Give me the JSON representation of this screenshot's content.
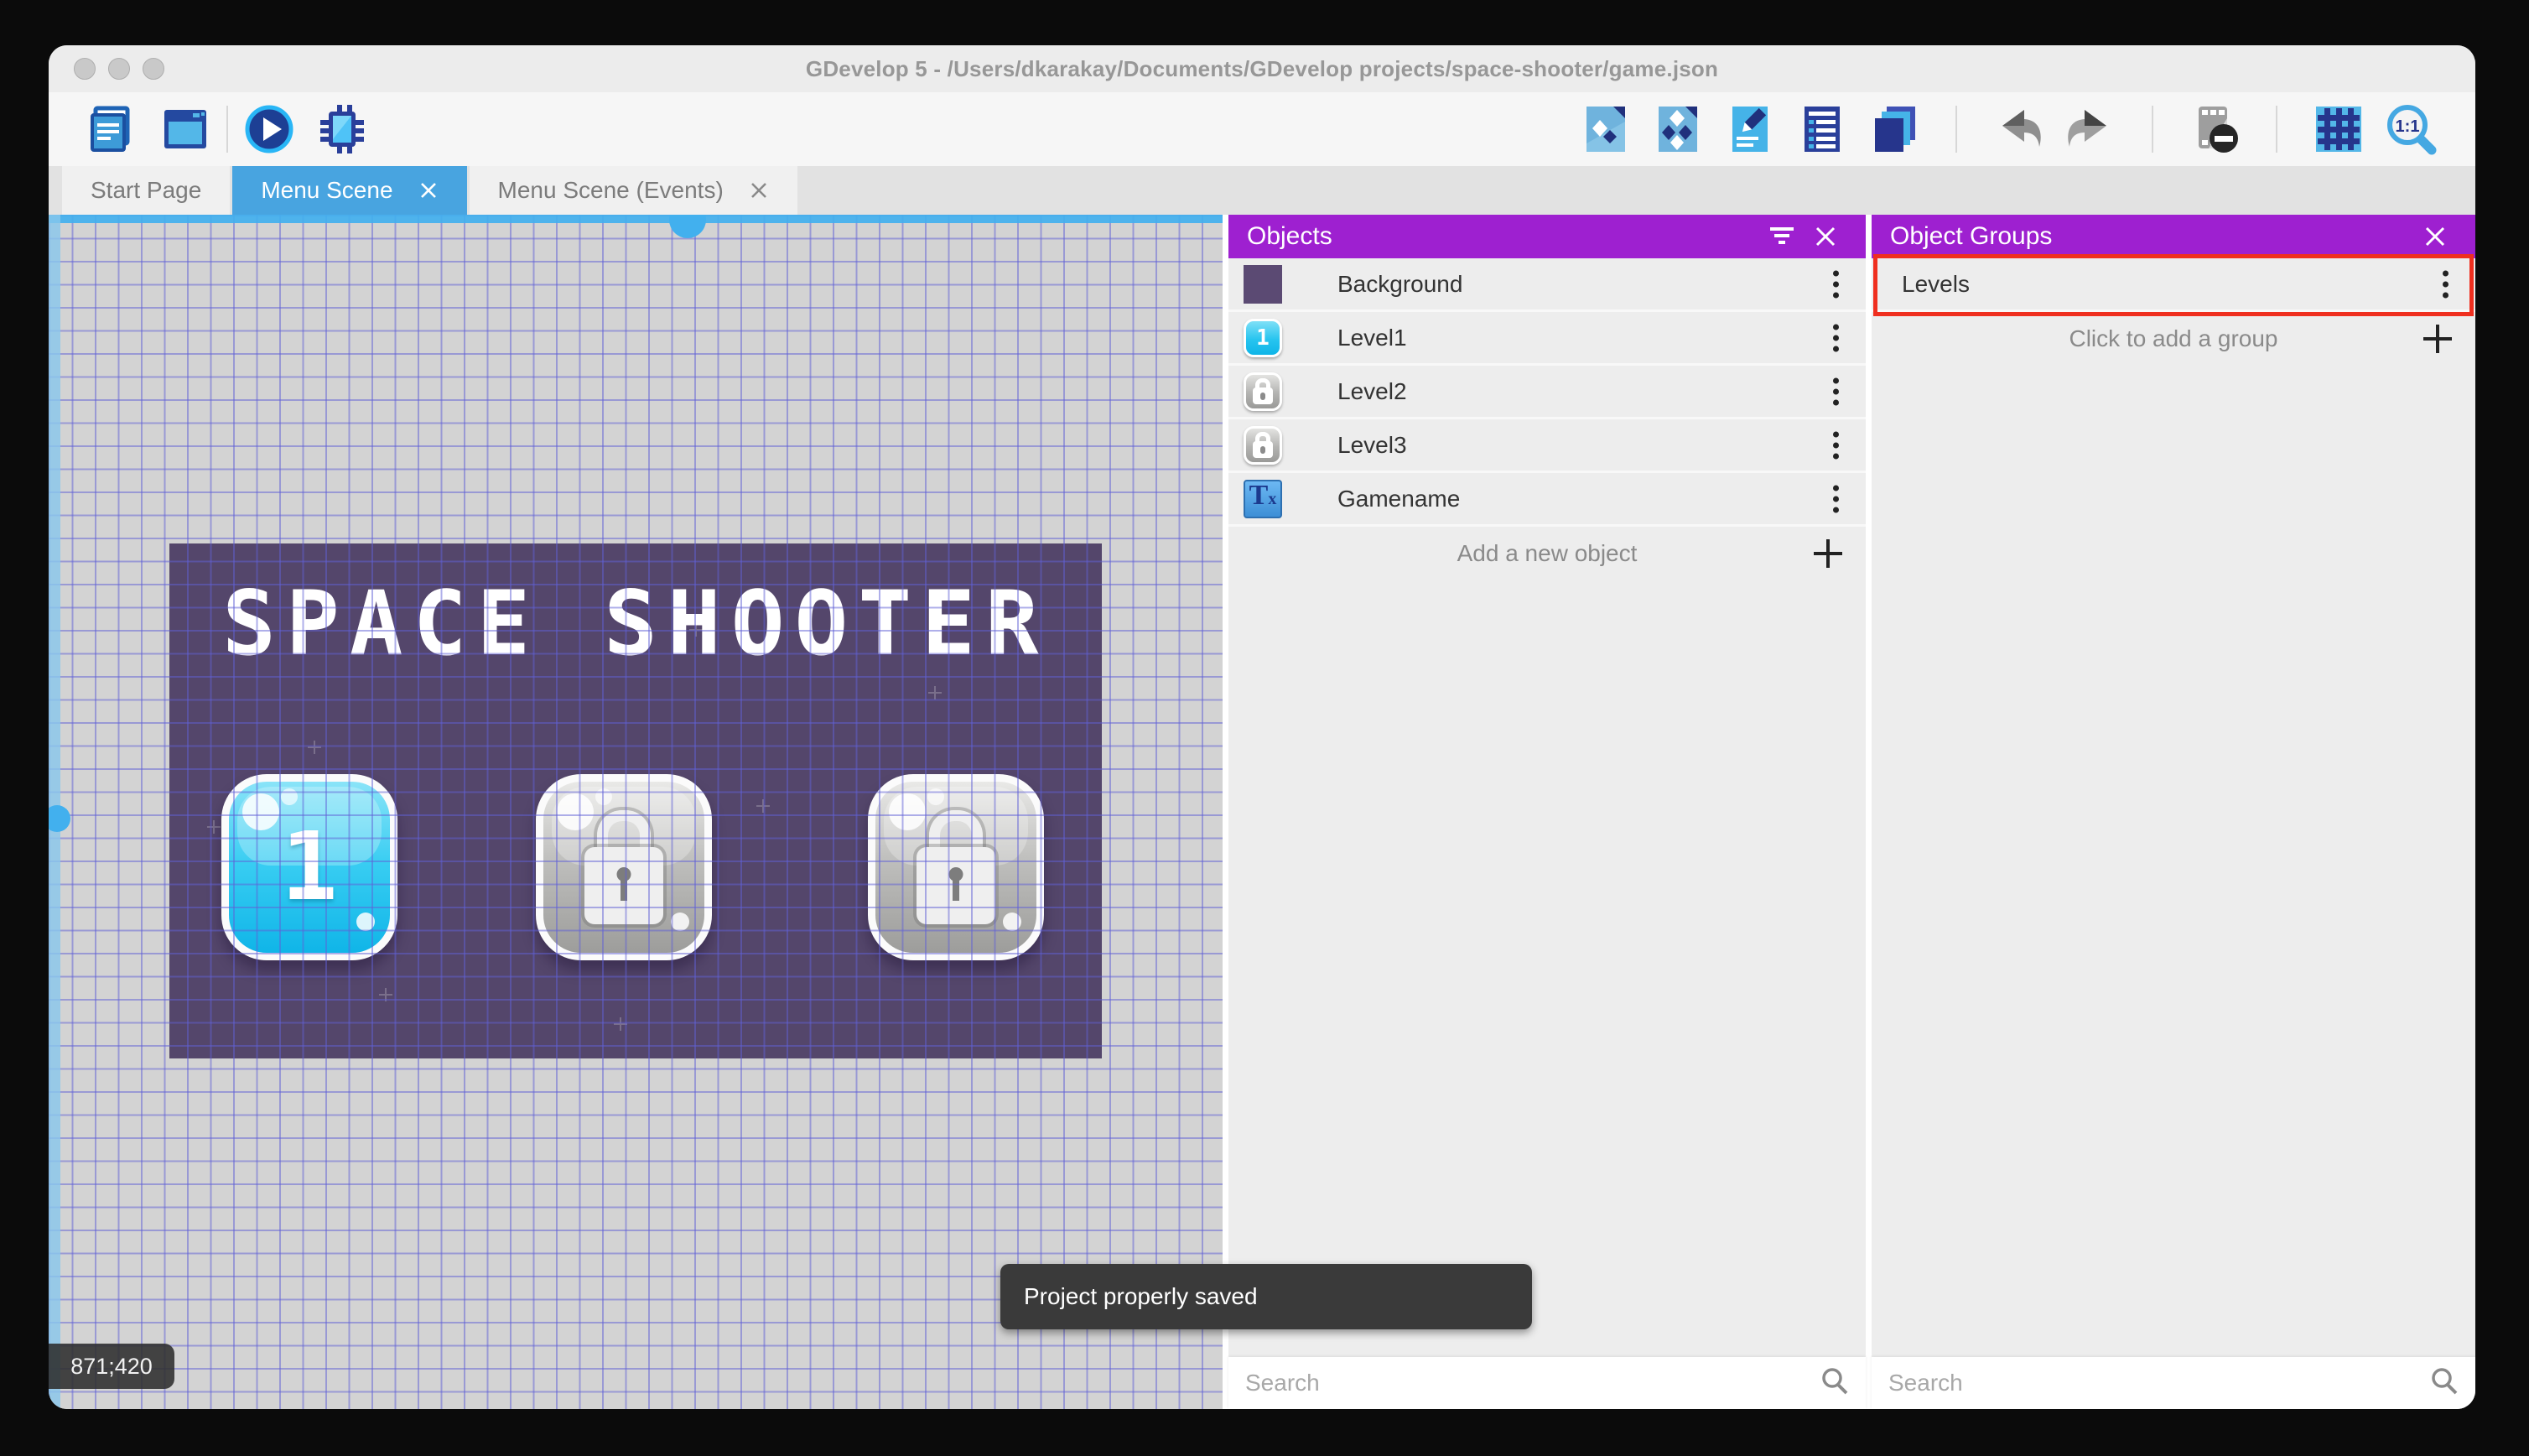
{
  "window_title": "GDevelop 5 - /Users/dkarakay/Documents/GDevelop projects/space-shooter/game.json",
  "tabs": {
    "start_page": "Start Page",
    "menu_scene": "Menu Scene",
    "menu_scene_events": "Menu Scene (Events)"
  },
  "canvas": {
    "coordinates": "871;420",
    "game_title": "SPACE SHOOTER",
    "level_buttons": [
      {
        "label": "1",
        "state": "unlocked"
      },
      {
        "state": "locked"
      },
      {
        "state": "locked"
      }
    ]
  },
  "objects_panel": {
    "title": "Objects",
    "items": [
      {
        "name": "Background"
      },
      {
        "name": "Level1",
        "badge": "1"
      },
      {
        "name": "Level2"
      },
      {
        "name": "Level3"
      },
      {
        "name": "Gamename"
      }
    ],
    "add_label": "Add a new object",
    "search_placeholder": "Search"
  },
  "object_groups_panel": {
    "title": "Object Groups",
    "groups": [
      {
        "name": "Levels",
        "highlighted": true
      }
    ],
    "add_label": "Click to add a group",
    "search_placeholder": "Search"
  },
  "toast_message": "Project properly saved",
  "icons": {
    "zoom_ratio_label": "1:1",
    "text_object_glyph_t": "T",
    "text_object_glyph_x": "x"
  },
  "colors": {
    "panel_header_purple": "#9e20d0",
    "active_tab_blue": "#48a4e0",
    "selection_blue": "#42b0ee",
    "game_background_purple": "#54466b",
    "highlight_red": "#ef2f1f",
    "toast_gray": "#3a3a3a"
  }
}
